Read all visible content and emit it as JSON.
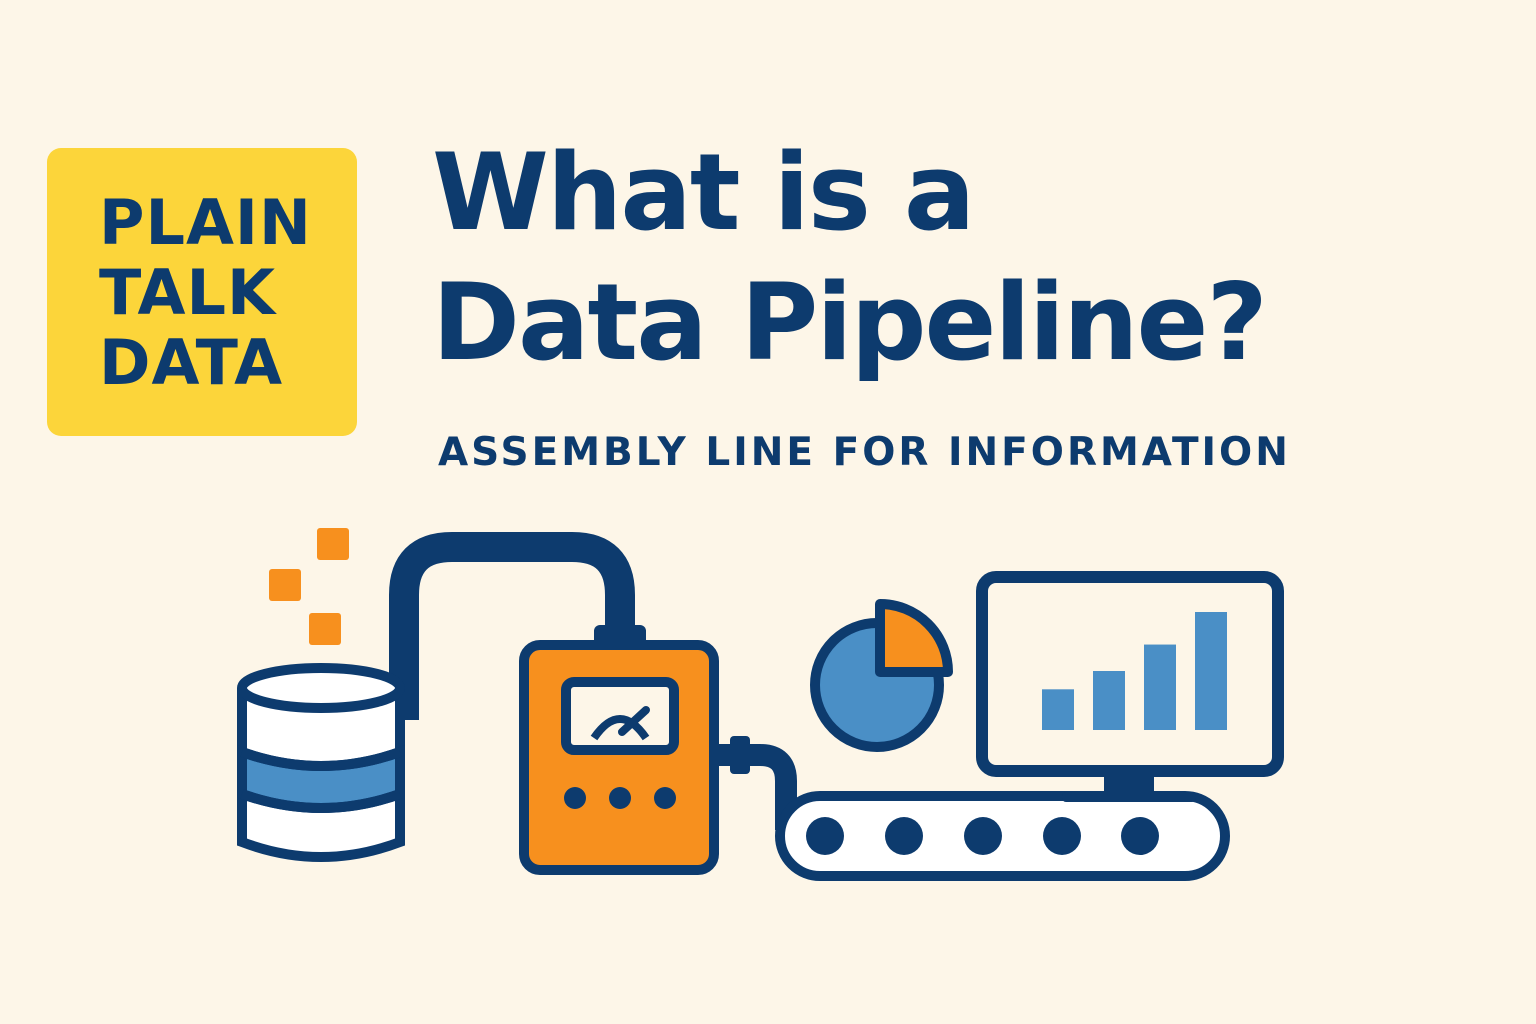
{
  "badge": {
    "lines": [
      "PLAIN",
      "TALK",
      "DATA"
    ]
  },
  "title": {
    "line1": "What is a",
    "line2": "Data Pipeline?"
  },
  "subtitle": "ASSEMBLY LINE FOR INFORMATION",
  "colors": {
    "background": "#fdf6e8",
    "navy": "#0d3b6e",
    "yellow": "#fcd53a",
    "orange": "#f7901e",
    "blue": "#4a8fc6"
  },
  "icons": [
    "data-squares-icon",
    "database-icon",
    "pipe-icon",
    "processor-machine-icon",
    "gauge-icon",
    "pie-chart-icon",
    "monitor-bar-chart-icon",
    "conveyor-belt-icon"
  ],
  "monitor_chart": {
    "values": [
      40,
      58,
      84,
      116
    ]
  },
  "pie_chart": {
    "highlighted_fraction": 0.25
  }
}
